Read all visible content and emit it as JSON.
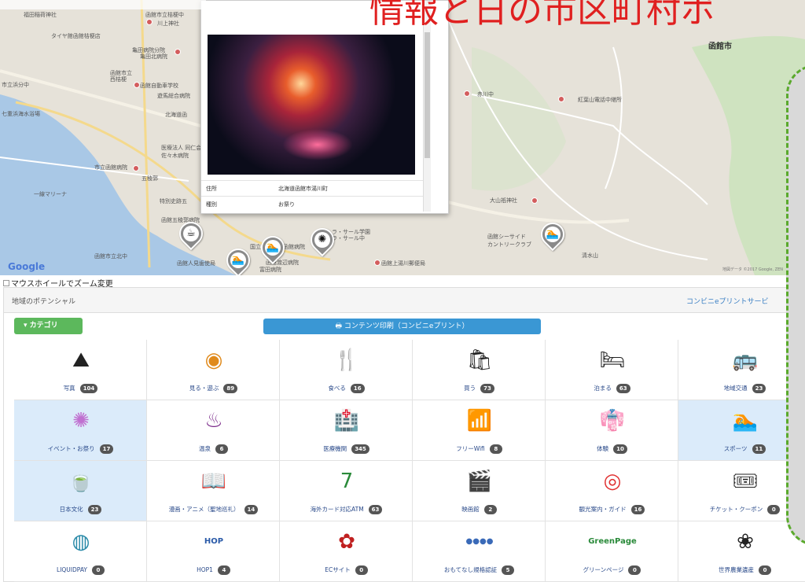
{
  "page": {
    "title": "情報と日の市区町村ポ"
  },
  "map": {
    "google_logo": "Google",
    "attribution": "地図データ ©2017 Google, ZEN",
    "city_label": "函館市",
    "labels": [
      "福田稲荷神社",
      "函館市立桔梗中",
      "川上神社",
      "タイヤ館函館桔梗店",
      "亀田病院分院",
      "亀田北病院",
      "函館市立",
      "西桔梗",
      "函館自動車学校",
      "遊馬総合病院",
      "北海道函",
      "市立浜分中",
      "赤川中",
      "紅葉山電話中継所",
      "七重浜海水浴場",
      "医療法人 同仁会 佐々木病院",
      "市立函館病院",
      "五稜郭",
      "一線マリーナ",
      "特別史跡五",
      "大山祇神社",
      "函館五稜郭病院",
      "国立病院機構函館病院",
      "ラ・サール学園",
      "ラ・サール中",
      "函館シーサイド カントリークラブ",
      "清水山",
      "函館市立北中",
      "函館人見歯使局",
      "富田病院",
      "函館上湯川郵便局",
      "函館渡辺病院"
    ],
    "popup": {
      "address_key": "住所",
      "address_val": "北海道函館市湯川町",
      "type_key": "種別",
      "type_val": "お祭り"
    }
  },
  "zoom_option": "マウスホイールでズーム変更",
  "panel": {
    "heading": "地域のポテンシャル",
    "print_link": "コンビニeプリントサービ",
    "category_button": "▾ カテゴリ",
    "print_button": "🖶 コンテンツ印刷（コンビニeプリント）"
  },
  "categories": [
    {
      "label": "写真",
      "count": "104",
      "icon": "camera-icon",
      "glyph": "⛰",
      "color": "#222",
      "hl": false
    },
    {
      "label": "見る・遊ぶ",
      "count": "89",
      "icon": "see-play-icon",
      "glyph": "◉",
      "color": "#e08a1c",
      "hl": false
    },
    {
      "label": "食べる",
      "count": "16",
      "icon": "eat-icon",
      "glyph": "🍴",
      "color": "#d4432a",
      "hl": false
    },
    {
      "label": "買う",
      "count": "73",
      "icon": "shopping-bag-icon",
      "glyph": "🛍",
      "color": "#222",
      "hl": false
    },
    {
      "label": "泊まる",
      "count": "63",
      "icon": "hotel-icon",
      "glyph": "🛏",
      "color": "#222",
      "hl": false
    },
    {
      "label": "地域交通",
      "count": "23",
      "icon": "bus-icon",
      "glyph": "🚌",
      "color": "#222",
      "hl": false
    },
    {
      "label": "イベント・お祭り",
      "count": "17",
      "icon": "event-icon",
      "glyph": "✺",
      "color": "#c070d0",
      "hl": true
    },
    {
      "label": "温泉",
      "count": "6",
      "icon": "hot-spring-icon",
      "glyph": "♨",
      "color": "#7b2a8a",
      "hl": false
    },
    {
      "label": "医療機関",
      "count": "345",
      "icon": "hospital-icon",
      "glyph": "🏥",
      "color": "#222",
      "hl": false
    },
    {
      "label": "フリーWifi",
      "count": "8",
      "icon": "wifi-icon",
      "glyph": "📶",
      "color": "#222",
      "hl": false
    },
    {
      "label": "体験",
      "count": "10",
      "icon": "experience-icon",
      "glyph": "👘",
      "color": "#222",
      "hl": false
    },
    {
      "label": "スポーツ",
      "count": "11",
      "icon": "swimming-icon",
      "glyph": "🏊",
      "color": "#222",
      "hl": true
    },
    {
      "label": "日本文化",
      "count": "23",
      "icon": "japanese-culture-icon",
      "glyph": "🍵",
      "color": "#222",
      "hl": true
    },
    {
      "label": "漫画・アニメ（聖地巡礼）",
      "count": "14",
      "icon": "manga-icon",
      "glyph": "📖",
      "color": "#222",
      "hl": false
    },
    {
      "label": "海外カード対応ATM",
      "count": "63",
      "icon": "atm-icon",
      "glyph": "7",
      "color": "#2a8a3a",
      "hl": false
    },
    {
      "label": "映画館",
      "count": "2",
      "icon": "cinema-icon",
      "glyph": "🎬",
      "color": "#222",
      "hl": false
    },
    {
      "label": "観光案内・ガイド",
      "count": "16",
      "icon": "target-icon",
      "glyph": "◎",
      "color": "#e03030",
      "hl": false
    },
    {
      "label": "チケット・クーポン",
      "count": "0",
      "icon": "ticket-icon",
      "glyph": "🎟",
      "color": "#222",
      "hl": false
    },
    {
      "label": "LIQUIDPAY",
      "count": "0",
      "icon": "liquidpay-icon",
      "glyph": "◍",
      "color": "#2a8aa8",
      "hl": false
    },
    {
      "label": "HOP1",
      "count": "4",
      "icon": "hop-icon",
      "glyph": "HOP",
      "color": "#2a5aa8",
      "hl": false
    },
    {
      "label": "ECサイト",
      "count": "0",
      "icon": "ec-site-icon",
      "glyph": "✿",
      "color": "#c02020",
      "hl": false
    },
    {
      "label": "おもてなし規格認証",
      "count": "5",
      "icon": "omotenashi-icon",
      "glyph": "●●●●",
      "color": "#3a6ab8",
      "hl": false
    },
    {
      "label": "グリーンページ",
      "count": "0",
      "icon": "greenpage-icon",
      "glyph": "GreenPage",
      "color": "#2a8a3a",
      "hl": false
    },
    {
      "label": "世界農業遺産",
      "count": "0",
      "icon": "agri-heritage-icon",
      "glyph": "❀",
      "color": "#222",
      "hl": false
    }
  ]
}
